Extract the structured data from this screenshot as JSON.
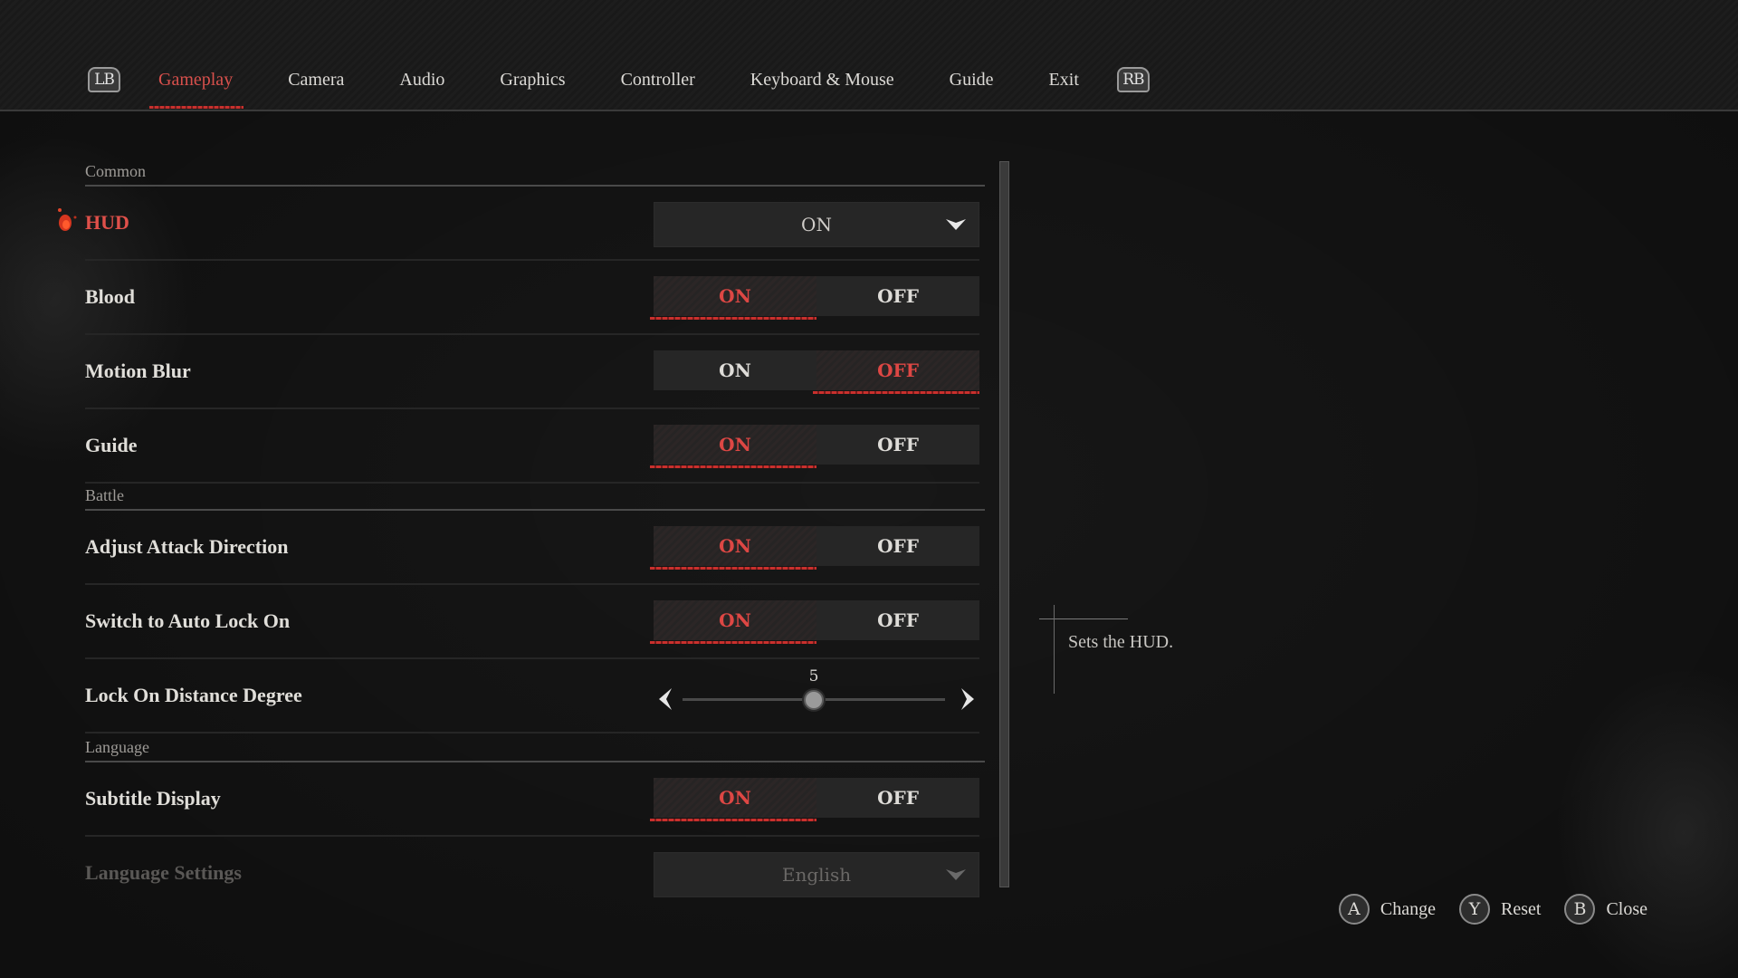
{
  "header": {
    "left_bumper": "LB",
    "right_bumper": "RB",
    "tabs": [
      {
        "label": "Gameplay",
        "active": true
      },
      {
        "label": "Camera",
        "active": false
      },
      {
        "label": "Audio",
        "active": false
      },
      {
        "label": "Graphics",
        "active": false
      },
      {
        "label": "Controller",
        "active": false
      },
      {
        "label": "Keyboard & Mouse",
        "active": false
      },
      {
        "label": "Guide",
        "active": false
      },
      {
        "label": "Exit",
        "active": false
      }
    ]
  },
  "settings": {
    "sections": {
      "common": "Common",
      "battle": "Battle",
      "language": "Language"
    },
    "hud": {
      "label": "HUD",
      "value": "ON",
      "type": "dropdown",
      "selected": true
    },
    "blood": {
      "label": "Blood",
      "on": "ON",
      "off": "OFF",
      "value": "ON"
    },
    "motion_blur": {
      "label": "Motion Blur",
      "on": "ON",
      "off": "OFF",
      "value": "OFF"
    },
    "guide": {
      "label": "Guide",
      "on": "ON",
      "off": "OFF",
      "value": "ON"
    },
    "adjust_attack_direction": {
      "label": "Adjust Attack Direction",
      "on": "ON",
      "off": "OFF",
      "value": "ON"
    },
    "auto_lock_on": {
      "label": "Switch to Auto Lock On",
      "on": "ON",
      "off": "OFF",
      "value": "ON"
    },
    "lock_on_distance": {
      "label": "Lock On Distance Degree",
      "value": "5",
      "fraction": 0.5
    },
    "subtitle_display": {
      "label": "Subtitle Display",
      "on": "ON",
      "off": "OFF",
      "value": "ON"
    },
    "language_settings": {
      "label": "Language Settings",
      "value": "English",
      "type": "dropdown",
      "disabled": true
    }
  },
  "description": {
    "text": "Sets the HUD."
  },
  "footer": [
    {
      "button": "A",
      "label": "Change"
    },
    {
      "button": "Y",
      "label": "Reset"
    },
    {
      "button": "B",
      "label": "Close"
    }
  ],
  "colors": {
    "accent": "#dd4744",
    "background": "#171717",
    "text": "#dedcd8"
  }
}
